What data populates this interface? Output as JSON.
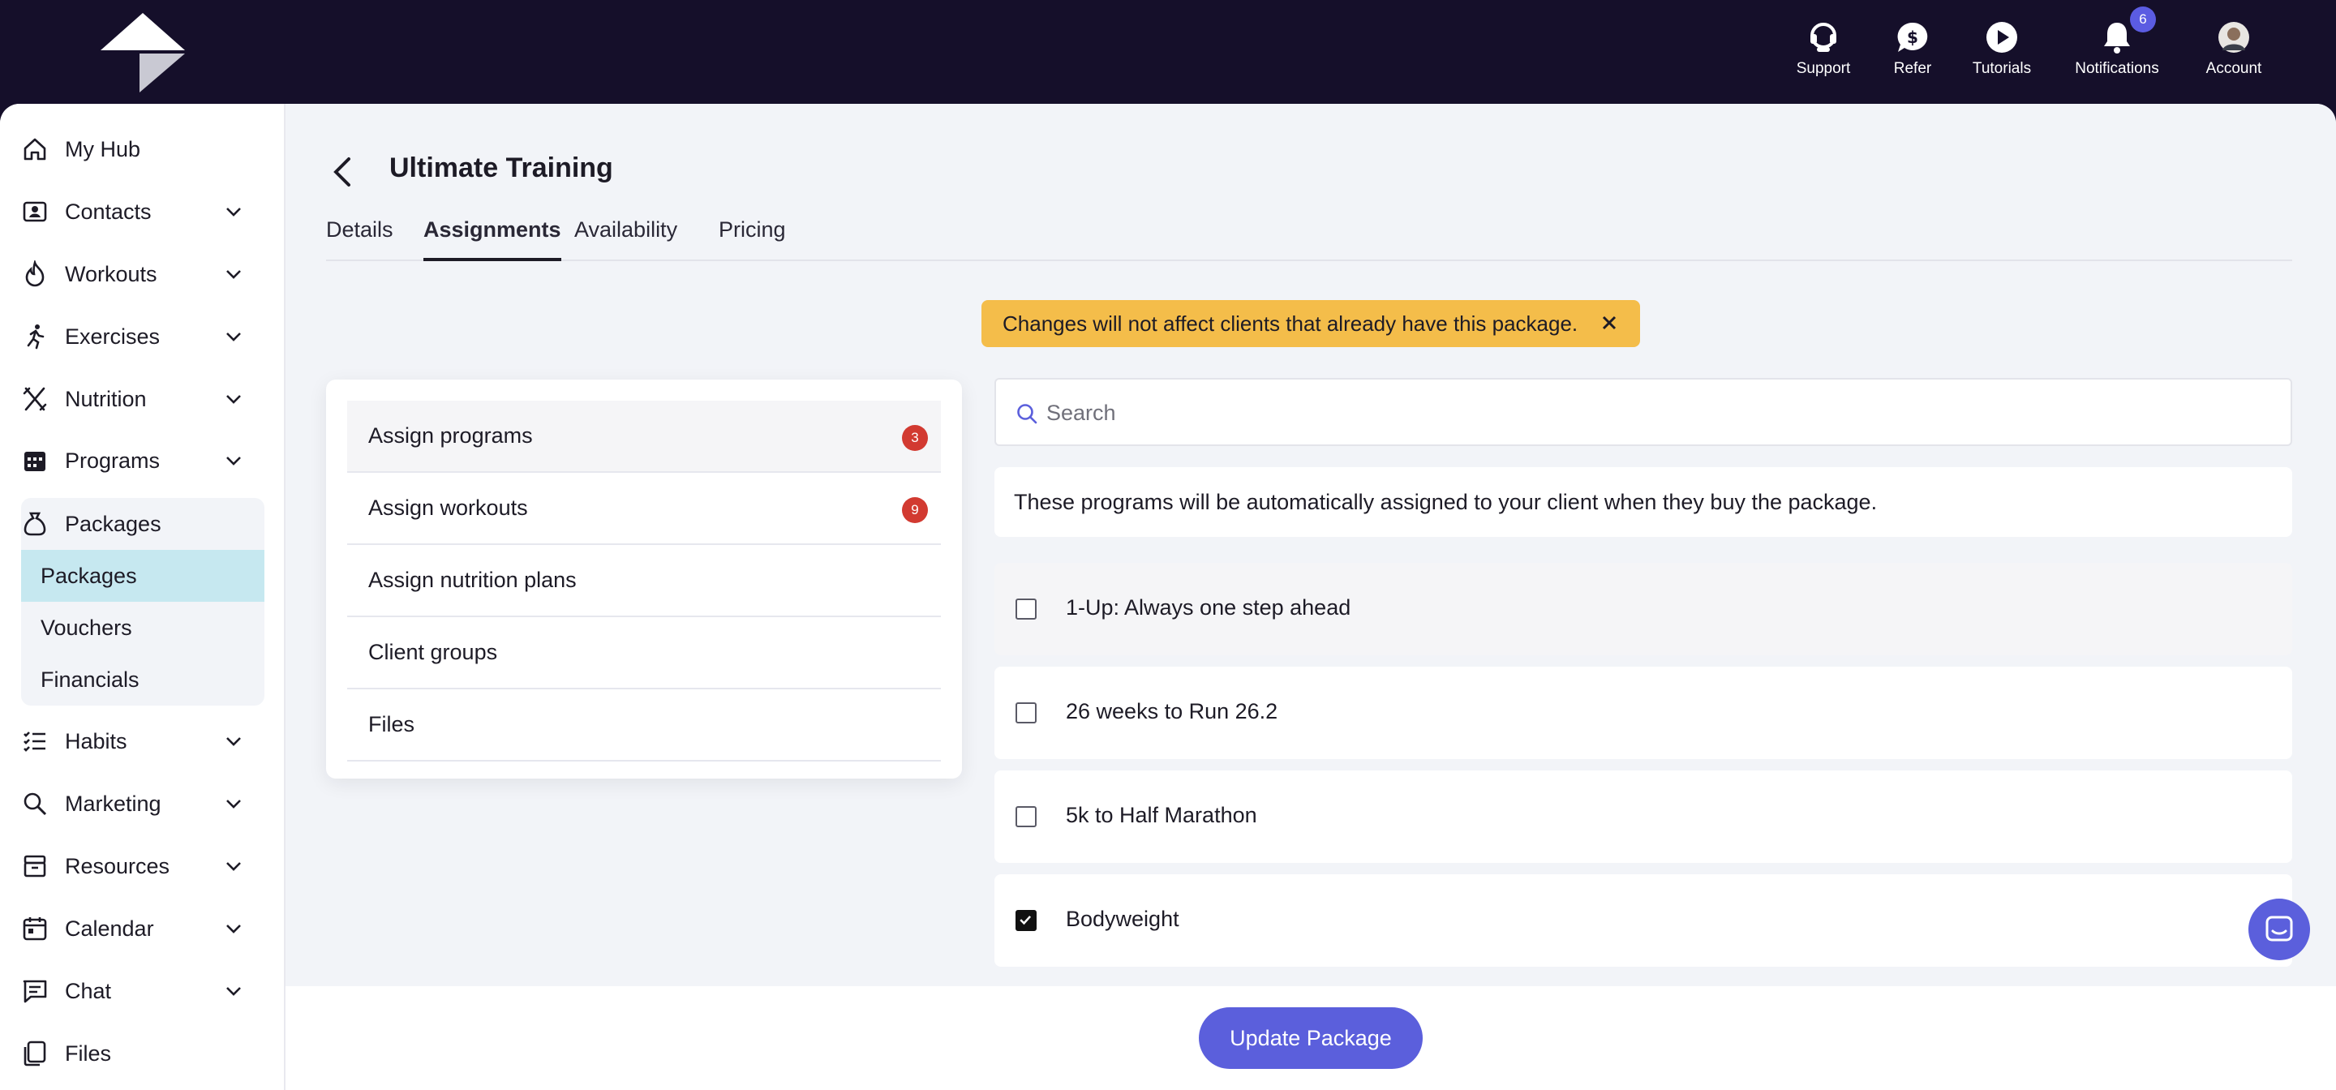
{
  "topnav": {
    "items": [
      {
        "label": "Support",
        "icon": "support-icon"
      },
      {
        "label": "Refer",
        "icon": "dollar-chat-icon"
      },
      {
        "label": "Tutorials",
        "icon": "play-icon"
      },
      {
        "label": "Notifications",
        "icon": "bell-icon",
        "badge": "6"
      },
      {
        "label": "Account",
        "icon": "avatar"
      }
    ]
  },
  "sidebar": {
    "items": [
      {
        "label": "My Hub",
        "icon": "home-icon"
      },
      {
        "label": "Contacts",
        "icon": "contacts-icon"
      },
      {
        "label": "Workouts",
        "icon": "fire-icon"
      },
      {
        "label": "Exercises",
        "icon": "runner-icon"
      },
      {
        "label": "Nutrition",
        "icon": "cutlery-icon"
      },
      {
        "label": "Programs",
        "icon": "calendar-grid-icon"
      },
      {
        "label": "Packages",
        "icon": "money-bag-icon"
      },
      {
        "label": "Habits",
        "icon": "checklist-icon"
      },
      {
        "label": "Marketing",
        "icon": "magnifier-icon"
      },
      {
        "label": "Resources",
        "icon": "archive-icon"
      },
      {
        "label": "Calendar",
        "icon": "calendar-icon"
      },
      {
        "label": "Chat",
        "icon": "chat-icon"
      },
      {
        "label": "Files",
        "icon": "files-icon"
      }
    ],
    "packages_sub": [
      {
        "label": "Packages"
      },
      {
        "label": "Vouchers"
      },
      {
        "label": "Financials"
      }
    ]
  },
  "page": {
    "title": "Ultimate Training",
    "tabs": [
      "Details",
      "Assignments",
      "Availability",
      "Pricing"
    ],
    "active_tab": "Assignments",
    "banner": "Changes will not affect clients that already have this package."
  },
  "assign_menu": [
    {
      "label": "Assign programs",
      "count": "3"
    },
    {
      "label": "Assign workouts",
      "count": "9"
    },
    {
      "label": "Assign nutrition plans",
      "count": ""
    },
    {
      "label": "Client groups",
      "count": ""
    },
    {
      "label": "Files",
      "count": ""
    }
  ],
  "search": {
    "placeholder": "Search"
  },
  "info_text": "These programs will be automatically assigned to your client when they buy the package.",
  "programs": [
    {
      "label": "1-Up: Always one step ahead",
      "checked": false
    },
    {
      "label": "26 weeks to Run 26.2",
      "checked": false
    },
    {
      "label": "5k to Half Marathon",
      "checked": false
    },
    {
      "label": "Bodyweight",
      "checked": true
    }
  ],
  "footer": {
    "update_label": "Update Package"
  },
  "colors": {
    "topbar": "#150f2a",
    "accent": "#5b5fdc",
    "banner": "#f4bd4a",
    "badge": "#d23a31",
    "active_sub": "#c6e8f0"
  }
}
